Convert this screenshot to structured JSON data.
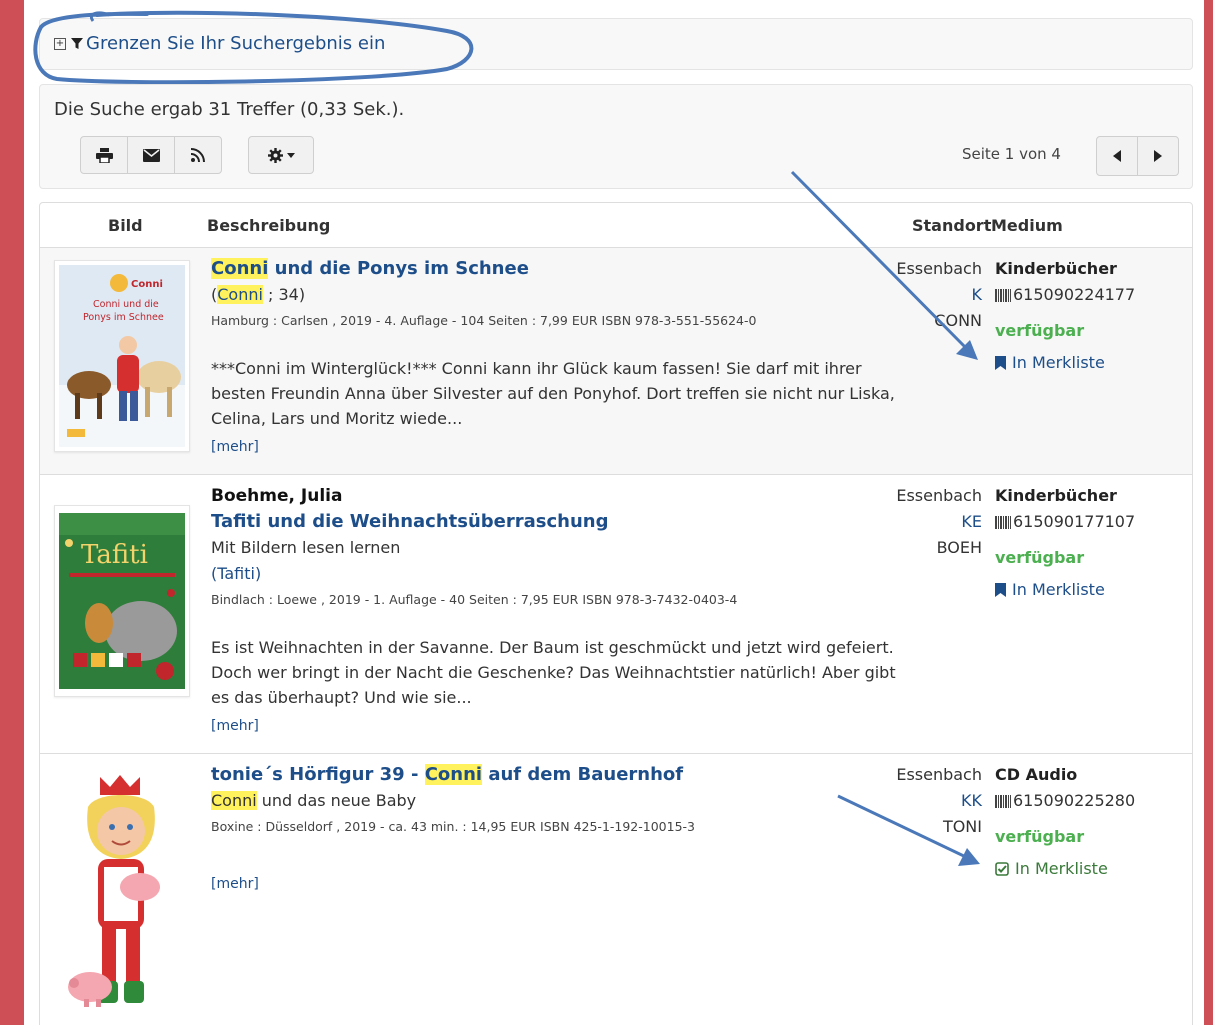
{
  "filter": {
    "label": "Grenzen Sie Ihr Suchergebnis ein"
  },
  "results": {
    "count_text": "Die Suche ergab 31 Treffer (0,33 Sek.).",
    "page_info": "Seite 1 von 4"
  },
  "table": {
    "headers": {
      "image": "Bild",
      "description": "Beschreibung",
      "location": "Standort",
      "medium": "Medium"
    }
  },
  "items": [
    {
      "title_hl": "Conni",
      "title_rest": " und die Ponys im Schnee",
      "series_open": "(",
      "series_hl": "Conni",
      "series_rest": " ; 34)",
      "publication": "Hamburg : Carlsen , 2019 - 4. Auflage - 104 Seiten : 7,99 EUR ISBN 978-3-551-55624-0",
      "abstract": "***Conni im Winterglück!*** Conni kann ihr Glück kaum fassen! Sie darf mit ihrer besten Freundin Anna über Silvester auf den Ponyhof. Dort treffen sie nicht nur Liska, Celina, Lars und Moritz wiede...",
      "more": "[mehr]",
      "location": [
        "Essenbach",
        "K",
        "CONN"
      ],
      "medium": "Kinderbücher",
      "barcode": "615090224177",
      "availability": "verfügbar",
      "merkliste": "In Merkliste",
      "cover": {
        "brand": "Conni",
        "title_line1": "Conni und die",
        "title_line2": "Ponys im Schnee"
      }
    },
    {
      "author": "Boehme, Julia",
      "title": "Tafiti und die Weihnachtsüberraschung",
      "subtitle": "Mit Bildern lesen lernen",
      "series": "(Tafiti)",
      "publication": "Bindlach : Loewe , 2019 - 1. Auflage - 40 Seiten : 7,95 EUR ISBN 978-3-7432-0403-4",
      "abstract": "Es ist Weihnachten in der Savanne. Der Baum ist geschmückt und jetzt wird gefeiert. Doch wer bringt in der Nacht die Geschenke? Das Weihnachtstier natürlich! Aber gibt es das überhaupt? Und wie sie...",
      "more": "[mehr]",
      "location": [
        "Essenbach",
        "KE",
        "BOEH"
      ],
      "medium": "Kinderbücher",
      "barcode": "615090177107",
      "availability": "verfügbar",
      "merkliste": "In Merkliste",
      "cover": {
        "title": "Tafiti"
      }
    },
    {
      "title_pre": "tonie´s Hörfigur 39 - ",
      "title_hl": "Conni",
      "title_rest": " auf dem Bauernhof",
      "subtitle_hl": "Conni",
      "subtitle_rest": " und das neue Baby",
      "publication": "Boxine : Düsseldorf , 2019 - ca. 43 min. : 14,95 EUR ISBN 425-1-192-10015-3",
      "more": "[mehr]",
      "location": [
        "Essenbach",
        "KK",
        "TONI"
      ],
      "medium": "CD Audio",
      "barcode": "615090225280",
      "availability": "verfügbar",
      "merkliste": "In Merkliste"
    }
  ],
  "icons": [
    "plus-square-icon",
    "filter-icon",
    "print-icon",
    "envelope-icon",
    "rss-icon",
    "gear-icon",
    "caret-down-icon",
    "chevron-left-icon",
    "chevron-right-icon",
    "barcode-icon",
    "bookmark-icon",
    "check-square-icon",
    "arrow-annotation-icon"
  ],
  "colors": {
    "link": "#1d4e89",
    "available": "#4caf50",
    "highlight": "#fff25c",
    "side_border": "#cf4f57",
    "annotation": "#4a78b8"
  }
}
